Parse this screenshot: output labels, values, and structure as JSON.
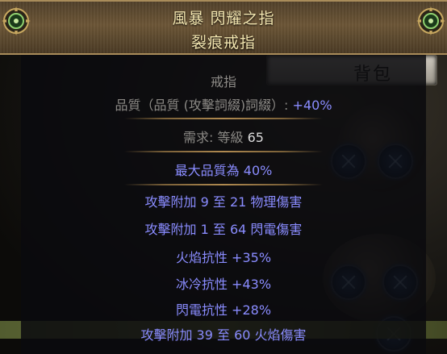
{
  "inventory": {
    "tab_label": "背包"
  },
  "item": {
    "name": "風暴 閃耀之指",
    "base_type": "裂痕戒指",
    "item_class": "戒指",
    "quality_label": "品質（品質 (攻擊詞綴)詞綴）: ",
    "quality_value": "+40%",
    "requirement_label": "需求: 等級 ",
    "requirement_value": "65",
    "enchant": "最大品質為 40%",
    "modifiers": [
      "攻擊附加 9 至 21 物理傷害",
      "攻擊附加 1 至 64 閃電傷害",
      "火焰抗性 +35%",
      "冰冷抗性 +43%",
      "閃電抗性 +28%",
      "攻擊附加 39 至 60 火焰傷害"
    ]
  },
  "colors": {
    "header_text": "#f3e6b0",
    "property_text": "#8c8a86",
    "value_text": "#dcdcdc",
    "magic_mod_text": "#8a8cff",
    "header_bg": "#6b5536"
  }
}
